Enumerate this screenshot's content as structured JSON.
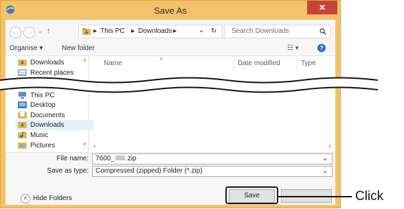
{
  "window": {
    "title": "Save As",
    "close_glyph": "✕",
    "accent": "#f3c26a",
    "close_color": "#c7443a"
  },
  "address": {
    "back_glyph": "←",
    "forward_glyph": "→",
    "recent_glyph": "⌄",
    "up_glyph": "↑",
    "path": [
      "This PC",
      "Downloads"
    ],
    "sep": "▸",
    "refresh_glyph": "↻",
    "dropdown_glyph": "⌄"
  },
  "search": {
    "placeholder": "Search Downloads",
    "icon": "search-icon"
  },
  "toolbar": {
    "organise": "Organise ▾",
    "new_folder": "New folder",
    "view_glyph": "☷ ▾",
    "help_glyph": "?"
  },
  "nav_top": [
    {
      "label": "Downloads",
      "icon": "downloads-folder-icon"
    },
    {
      "label": "Recent places",
      "icon": "recent-places-icon"
    }
  ],
  "nav_partial": "This PC",
  "nav_bottom": [
    {
      "label": "Desktop",
      "icon": "desktop-folder-icon"
    },
    {
      "label": "Documents",
      "icon": "documents-folder-icon"
    },
    {
      "label": "Downloads",
      "icon": "downloads-folder-icon",
      "selected": true
    },
    {
      "label": "Music",
      "icon": "music-folder-icon"
    },
    {
      "label": "Pictures",
      "icon": "pictures-folder-icon"
    }
  ],
  "columns": {
    "name": "Name",
    "date": "Date modified",
    "type": "Type",
    "sort_glyph": "˄"
  },
  "file_name": {
    "label": "File name:",
    "value": "7600_",
    "value_suffix": ".zip"
  },
  "save_type": {
    "label": "Save as type:",
    "value": "Compressed (zipped) Folder (*.zip)"
  },
  "hide_folders": {
    "label": "Hide Folders",
    "glyph": "˄"
  },
  "buttons": {
    "save": "Save",
    "cancel": ""
  },
  "annotation": {
    "label": "Click"
  }
}
